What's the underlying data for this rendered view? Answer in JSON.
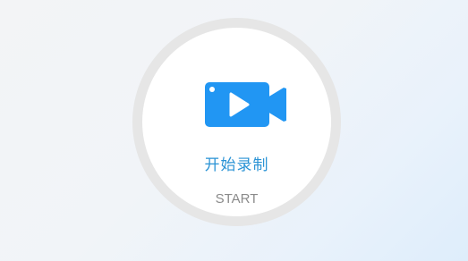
{
  "record_button": {
    "label_cn": "开始录制",
    "label_en": "START",
    "icon": "video-camera-play-icon",
    "colors": {
      "accent": "#2196f3",
      "label_cn": "#2a93d5",
      "label_en": "#8a8a8a",
      "ring": "#e6e6e6"
    }
  }
}
